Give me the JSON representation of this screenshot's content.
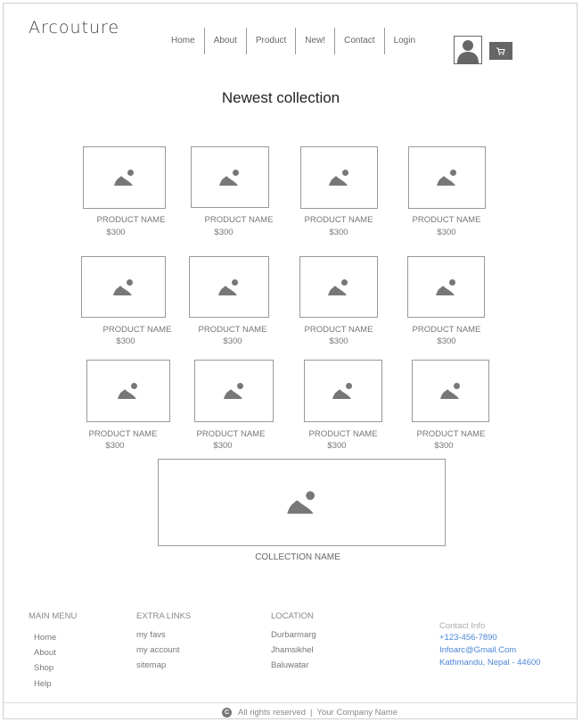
{
  "brand": "Arcouture",
  "nav": [
    {
      "label": "Home"
    },
    {
      "label": "About"
    },
    {
      "label": "Product"
    },
    {
      "label": "New!"
    },
    {
      "label": "Contact"
    },
    {
      "label": "Login"
    }
  ],
  "heading": "Newest collection",
  "products": [
    {
      "name": "PRODUCT NAME",
      "price": "$300"
    },
    {
      "name": "PRODUCT NAME",
      "price": "$300"
    },
    {
      "name": "PRODUCT NAME",
      "price": "$300"
    },
    {
      "name": "PRODUCT NAME",
      "price": "$300"
    },
    {
      "name": "PRODUCT NAME",
      "price": "$300"
    },
    {
      "name": "PRODUCT NAME",
      "price": "$300"
    },
    {
      "name": "PRODUCT NAME",
      "price": "$300"
    },
    {
      "name": "PRODUCT NAME",
      "price": "$300"
    },
    {
      "name": "PRODUCT NAME",
      "price": "$300"
    },
    {
      "name": "PRODUCT NAME",
      "price": "$300"
    },
    {
      "name": "PRODUCT NAME",
      "price": "$300"
    },
    {
      "name": "PRODUCT NAME",
      "price": "$300"
    }
  ],
  "collection": {
    "name": "COLLECTION NAME"
  },
  "footer": {
    "main_menu": {
      "title": "MAIN MENU",
      "items": [
        "Home",
        "About",
        "Shop",
        "Help"
      ]
    },
    "extra_links": {
      "title": "EXTRA LINKS",
      "items": [
        "my favs",
        "my account",
        "sitemap"
      ]
    },
    "location": {
      "title": "LOCATION",
      "items": [
        "Durbarmarg",
        "Jhamsikhel",
        "Baluwatar"
      ]
    },
    "contact": {
      "title": "Contact Info",
      "phone": "+123-456-7890",
      "email": "Infoarc@Gmail.Com",
      "address": "Kathmandu, Nepal - 44600"
    },
    "copyright": "All rights reserved",
    "company": "Your Company Name"
  },
  "icons": {
    "user": "user-icon",
    "cart": "cart-icon",
    "image": "image-placeholder-icon",
    "copyright": "copyright-icon"
  },
  "colors": {
    "link_blue": "#4a86d8",
    "icon_gray": "#777777"
  }
}
